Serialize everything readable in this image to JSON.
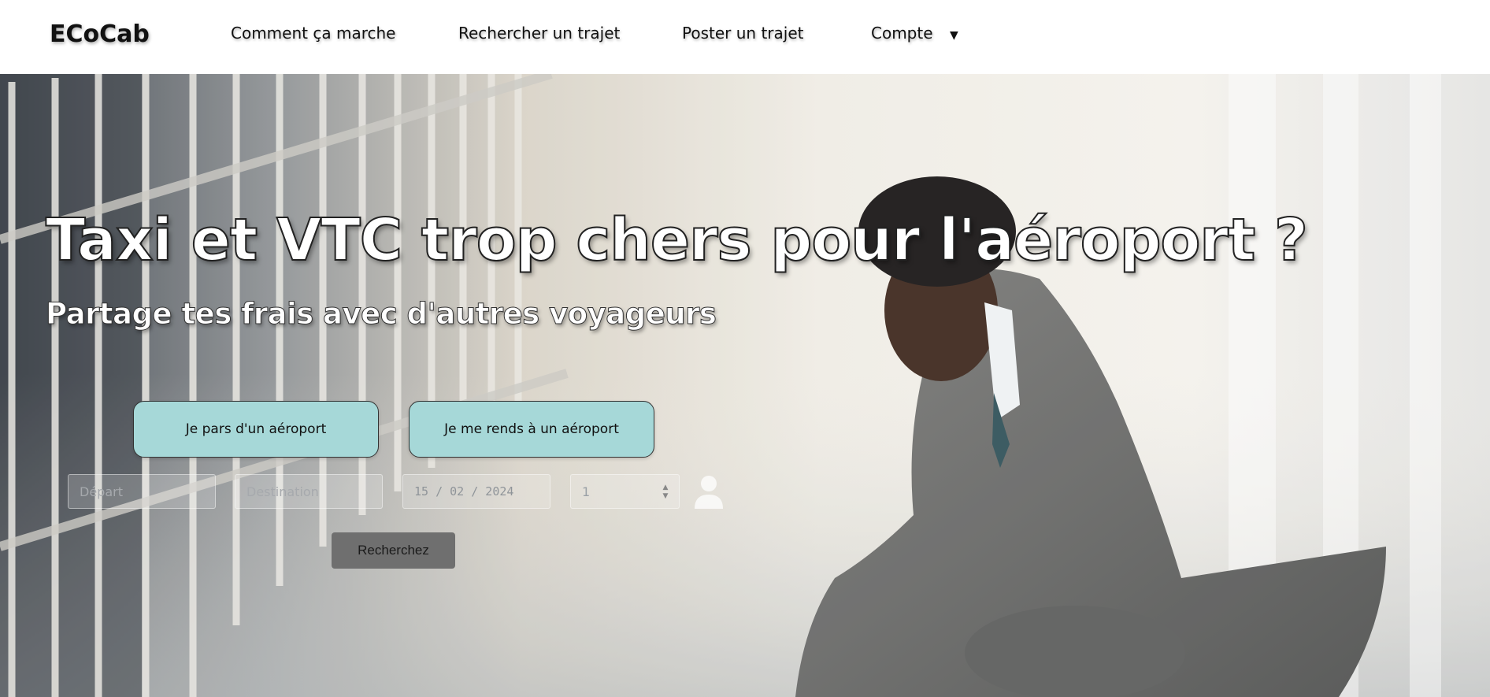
{
  "brand": {
    "logo": "ECoCab"
  },
  "nav": {
    "how_it_works": "Comment ça marche",
    "search_trip": "Rechercher un trajet",
    "post_trip": "Poster un trajet",
    "account": "Compte",
    "account_caret": "▼"
  },
  "hero": {
    "headline": "Taxi et VTC trop chers pour l'aéroport ?",
    "subheadline": "Partage tes frais avec d'autres voyageurs"
  },
  "search": {
    "mode_from_airport": "Je pars d'un aéroport",
    "mode_to_airport": "Je me rends à un aéroport",
    "departure_placeholder": "Départ",
    "destination_placeholder": "Destination",
    "date_value": "15 / 02 / 2024",
    "passengers_value": "1",
    "submit_label": "Recherchez"
  },
  "colors": {
    "mode_button_bg": "#a6d8d8",
    "search_button_bg": "#6f6f6f",
    "navbar_bg": "#ffffff"
  },
  "icons": {
    "passenger_icon": "user-icon",
    "account_dropdown": "caret-down-icon"
  }
}
